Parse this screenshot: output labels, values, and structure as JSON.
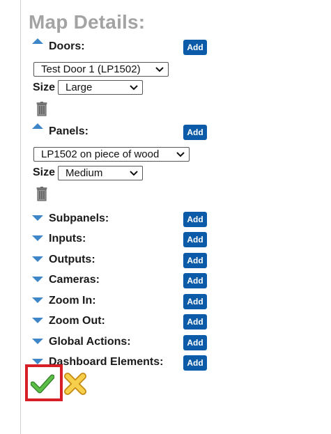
{
  "page": {
    "title": "Map Details:"
  },
  "doors": {
    "label": "Doors:",
    "add_label": "Add",
    "selected_door": "Test Door 1 (LP1502)",
    "size_label": "Size",
    "size_value": "Large"
  },
  "panels": {
    "label": "Panels:",
    "add_label": "Add",
    "selected_panel": "LP1502 on piece of wood",
    "size_label": "Size",
    "size_value": "Medium"
  },
  "sections": [
    {
      "label": "Subpanels:",
      "add_label": "Add"
    },
    {
      "label": "Inputs:",
      "add_label": "Add"
    },
    {
      "label": "Outputs:",
      "add_label": "Add"
    },
    {
      "label": "Cameras:",
      "add_label": "Add"
    },
    {
      "label": "Zoom In:",
      "add_label": "Add"
    },
    {
      "label": "Zoom Out:",
      "add_label": "Add"
    },
    {
      "label": "Global Actions:",
      "add_label": "Add"
    },
    {
      "label": "Dashboard Elements:",
      "add_label": "Add"
    }
  ],
  "icons": {
    "expand": "caret-up-icon",
    "collapse": "caret-down-icon",
    "delete": "trash-icon",
    "confirm": "checkmark-icon",
    "cancel": "x-icon"
  },
  "colors": {
    "accent": "#0b5ba8",
    "caret": "#3f86c9",
    "title": "#a3a3a3",
    "highlight": "#d61f26",
    "check": "#4aa83a",
    "cancel": "#f0c23c"
  }
}
